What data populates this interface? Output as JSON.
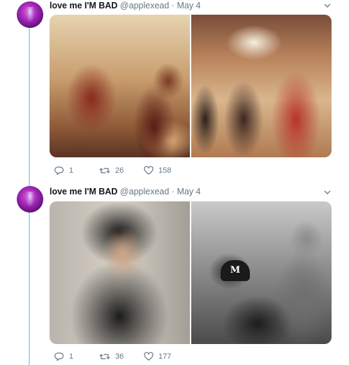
{
  "tweets": [
    {
      "author_name": "love me I'M BAD",
      "handle": "@applexead",
      "separator": "·",
      "date": "May 4",
      "reply_count": "1",
      "retweet_count": "26",
      "like_count": "158"
    },
    {
      "author_name": "love me I'M BAD",
      "handle": "@applexead",
      "separator": "·",
      "date": "May 4",
      "reply_count": "1",
      "retweet_count": "36",
      "like_count": "177"
    }
  ],
  "photo_text": {
    "cap_letter": "M"
  },
  "icons": [
    "reply-icon",
    "retweet-icon",
    "like-icon",
    "chevron-down-icon"
  ],
  "colors": {
    "accent": "#1da1f2",
    "thread_line": "#a8d9f4",
    "muted": "#657786"
  }
}
